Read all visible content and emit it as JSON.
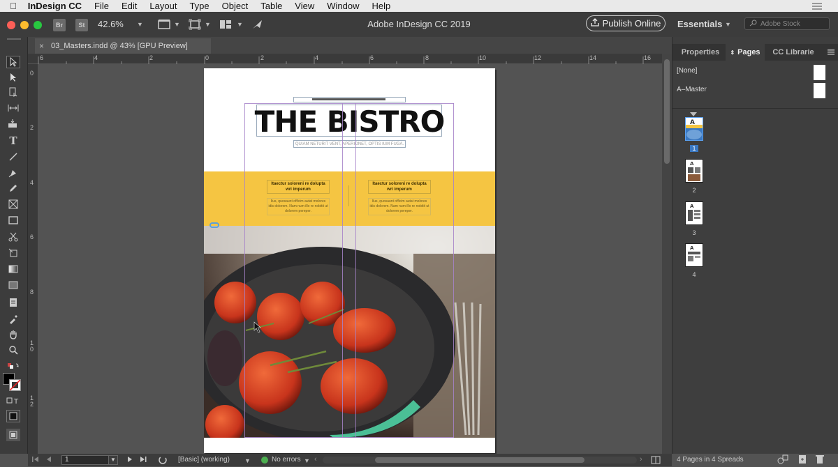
{
  "menubar": {
    "app_name": "InDesign CC",
    "items": [
      "File",
      "Edit",
      "Layout",
      "Type",
      "Object",
      "Table",
      "View",
      "Window",
      "Help"
    ]
  },
  "appbar": {
    "bridge_icon": "Br",
    "stock_icon": "St",
    "zoom": "42.6%",
    "window_title": "Adobe InDesign CC 2019",
    "publish_label": "Publish Online",
    "workspace": "Essentials",
    "search_placeholder": "Adobe Stock"
  },
  "document_tab": {
    "close": "×",
    "title": "03_Masters.indd @ 43% [GPU Preview]"
  },
  "rulers": {
    "horizontal": [
      "6",
      "4",
      "2",
      "0",
      "2",
      "4",
      "6",
      "8",
      "10",
      "12",
      "14",
      "16"
    ],
    "vertical": [
      "0",
      "2",
      "4",
      "6",
      "8",
      "1\n0",
      "1\n2"
    ]
  },
  "page": {
    "title": "THE BISTRO",
    "tagline": "QUIAM NETURIT VENT, APERIONET, OPTIS IUM FUGA.",
    "col1_head": "Itaectur soloreni re dolupta wri imperum",
    "col1_body": "Ilus, quosaunt officim autat molores idis dolorem. Nam num illo re nobitit ut dolorem pereper.",
    "col2_head": "Itaectur soloreni re dolupta wri imperum",
    "col2_body": "Ilus, quosaunt officim autat molores idis dolorem. Nam num illo re nobitit ut dolorem pereper."
  },
  "panel": {
    "tabs": [
      "Properties",
      "Pages",
      "CC Librarie"
    ],
    "masters": [
      "[None]",
      "A–Master"
    ],
    "pages": [
      "1",
      "2",
      "3",
      "4"
    ],
    "status": "4 Pages in 4 Spreads"
  },
  "statusbar": {
    "page_number": "1",
    "style": "[Basic] (working)",
    "errors": "No errors"
  },
  "colors": {
    "accent_yellow": "#f5c542",
    "guide_purple": "#a683c9",
    "no_errors_green": "#4caf50"
  }
}
